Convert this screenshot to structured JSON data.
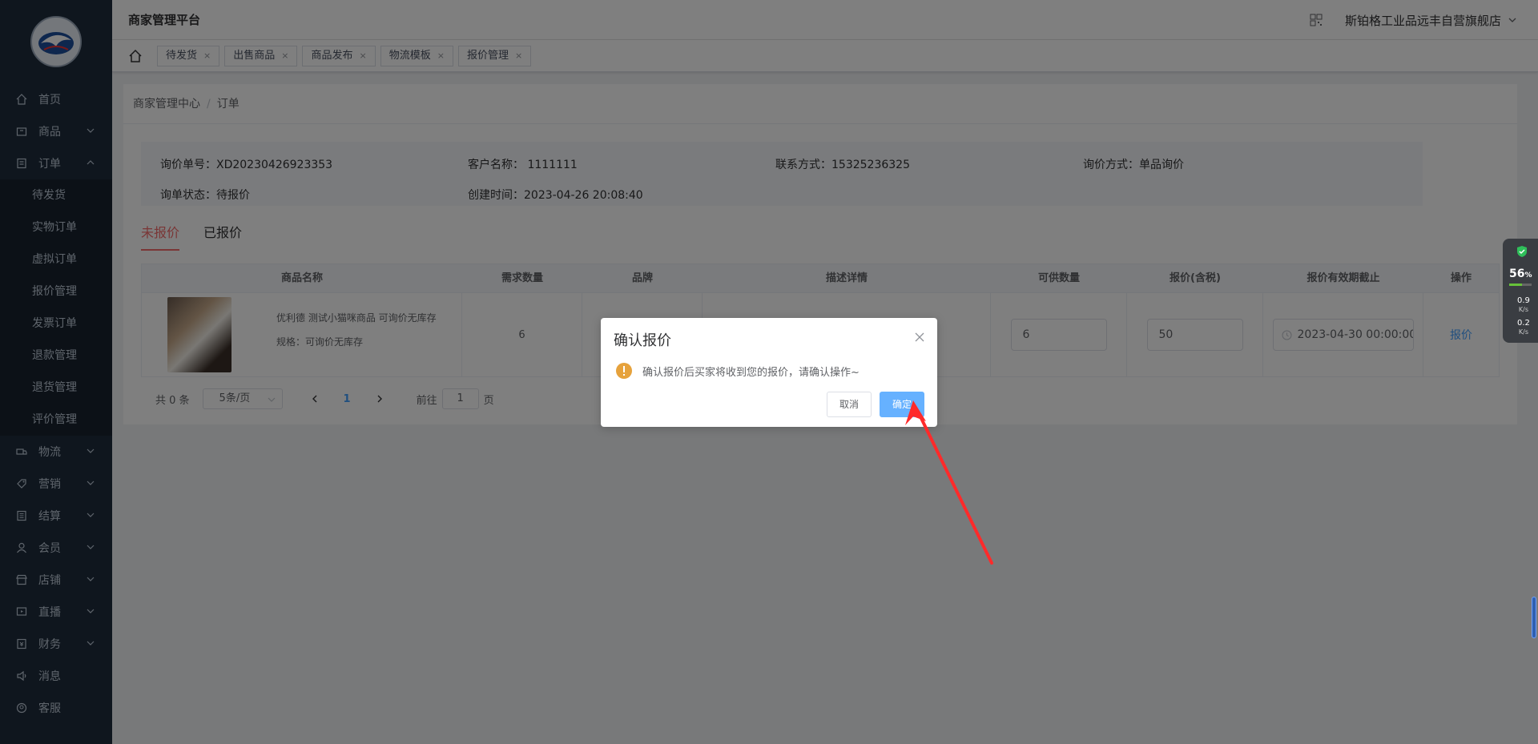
{
  "header": {
    "title": "商家管理平台",
    "shop_name": "斯铂格工业品远丰自营旗舰店"
  },
  "sidebar": {
    "items": [
      {
        "label": "首页",
        "icon": "home-icon"
      },
      {
        "label": "商品",
        "icon": "goods-icon"
      },
      {
        "label": "订单",
        "icon": "order-icon"
      }
    ],
    "order_sub": [
      "待发货",
      "实物订单",
      "虚拟订单",
      "报价管理",
      "发票订单",
      "退款管理",
      "退货管理",
      "评价管理"
    ],
    "items_after": [
      {
        "label": "物流",
        "icon": "truck-icon"
      },
      {
        "label": "营销",
        "icon": "tag-icon"
      },
      {
        "label": "结算",
        "icon": "ledger-icon"
      },
      {
        "label": "会员",
        "icon": "user-icon"
      },
      {
        "label": "店铺",
        "icon": "store-icon"
      },
      {
        "label": "直播",
        "icon": "live-icon"
      },
      {
        "label": "财务",
        "icon": "finance-icon"
      },
      {
        "label": "消息",
        "icon": "speaker-icon"
      },
      {
        "label": "客服",
        "icon": "service-icon"
      }
    ]
  },
  "tags": [
    "待发货",
    "出售商品",
    "商品发布",
    "物流模板",
    "报价管理"
  ],
  "breadcrumb": {
    "root": "商家管理中心",
    "current": "订单"
  },
  "info": {
    "inquiry_no": "询价单号：XD20230426923353",
    "customer": "客户名称：  1111111",
    "contact": "联系方式：15325236325",
    "method": "询价方式：单品询价",
    "status": "询单状态：待报价",
    "created": "创建时间：2023-04-26 20:08:40"
  },
  "tabs": {
    "unquoted": "未报价",
    "quoted": "已报价"
  },
  "table": {
    "headers": [
      "商品名称",
      "需求数量",
      "品牌",
      "描述详情",
      "可供数量",
      "报价(含税)",
      "报价有效期截止",
      "操作"
    ],
    "row": {
      "goods_name": "优利德 测试小猫咪商品 可询价无库存",
      "spec": "规格：可询价无库存",
      "qty": "6",
      "supply": "6",
      "price": "50",
      "expire": "2023-04-30 00:00:00",
      "action": "报价"
    }
  },
  "pager": {
    "total": "共 0 条",
    "size": "5条/页",
    "page": "1",
    "goto_label": "前往",
    "goto_value": "1",
    "page_suffix": "页"
  },
  "dialog": {
    "title": "确认报价",
    "message": "确认报价后买家将收到您的报价，请确认操作~",
    "cancel": "取消",
    "ok": "确定"
  },
  "widget": {
    "percent": "56",
    "percent_unit": "%",
    "up": "0.9",
    "down": "0.2",
    "unit": "K/s"
  },
  "colors": {
    "sidebar": "#1f2d3d",
    "accent": "#409eff",
    "active_tab": "#f56c6c",
    "warning": "#e6a23c",
    "arrow": "#ff2a2a"
  }
}
